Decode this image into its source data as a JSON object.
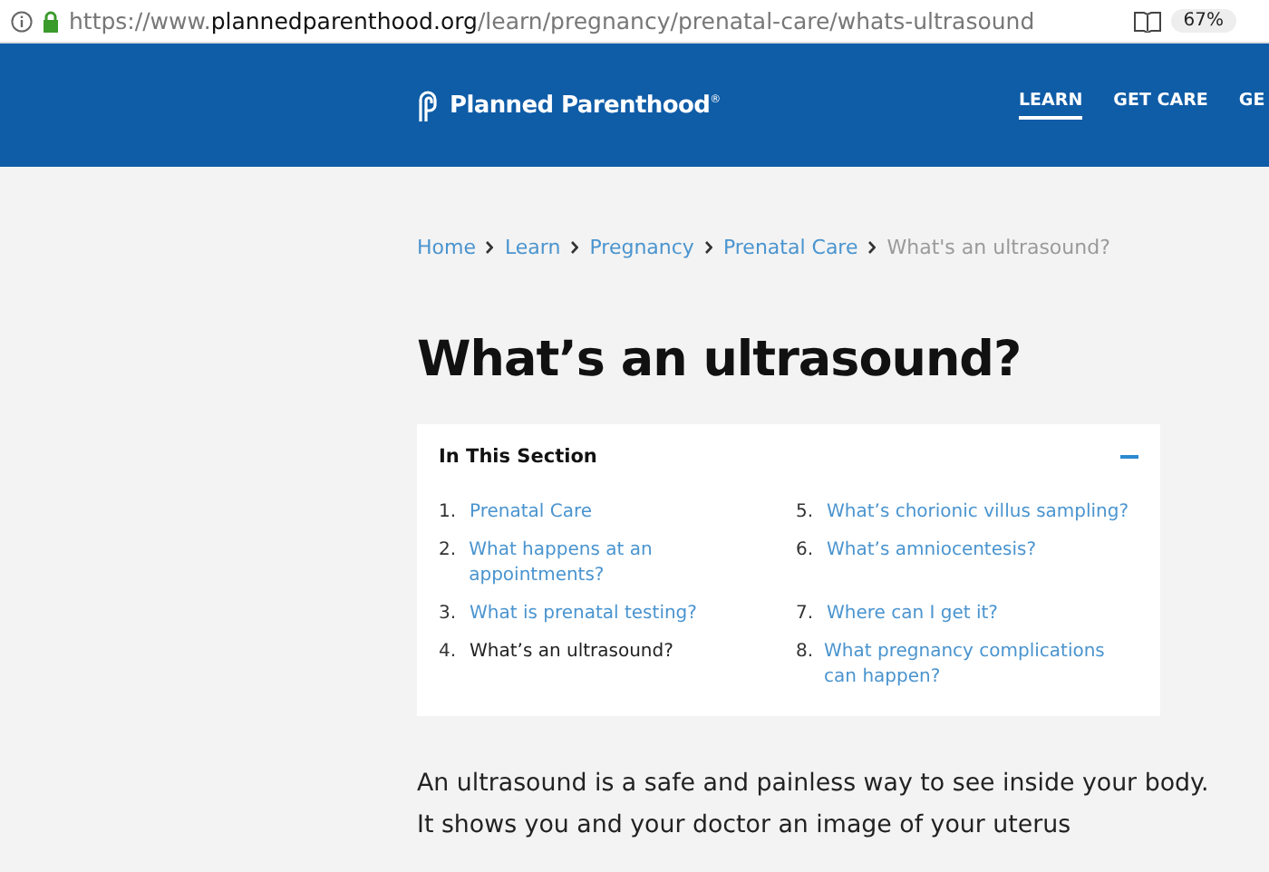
{
  "address_bar": {
    "url_prefix": "https://www.",
    "url_domain": "plannedparenthood.org",
    "url_path": "/learn/pregnancy/prenatal-care/whats-ultrasound",
    "zoom": "67%"
  },
  "header": {
    "logo": "Planned Parenthood",
    "logo_mark": "®",
    "nav": [
      {
        "label": "LEARN",
        "selected": true
      },
      {
        "label": "GET CARE",
        "selected": false
      },
      {
        "label": "GE",
        "selected": false
      }
    ]
  },
  "breadcrumb": [
    {
      "label": "Home",
      "current": false
    },
    {
      "label": "Learn",
      "current": false
    },
    {
      "label": "Pregnancy",
      "current": false
    },
    {
      "label": "Prenatal Care",
      "current": false
    },
    {
      "label": "What's an ultrasound?",
      "current": true
    }
  ],
  "title": "What’s an ultrasound?",
  "section": {
    "heading": "In This Section",
    "expanded": true,
    "items": [
      {
        "number": "1.",
        "label": "Prenatal Care",
        "selected": false
      },
      {
        "number": "2.",
        "label": "What happens at an appointments?",
        "selected": false
      },
      {
        "number": "3.",
        "label": "What is prenatal testing?",
        "selected": false
      },
      {
        "number": "4.",
        "label": "What’s an ultrasound?",
        "selected": true
      },
      {
        "number": "5.",
        "label": "What’s chorionic villus sampling?",
        "selected": false
      },
      {
        "number": "6.",
        "label": "What’s amniocentesis?",
        "selected": false
      },
      {
        "number": "7.",
        "label": "Where can I get it?",
        "selected": false
      },
      {
        "number": "8.",
        "label": "What pregnancy complications can happen?",
        "selected": false
      }
    ]
  },
  "body": "An ultrasound is a safe and painless way to see inside your body. It shows you and your doctor an image of your uterus"
}
